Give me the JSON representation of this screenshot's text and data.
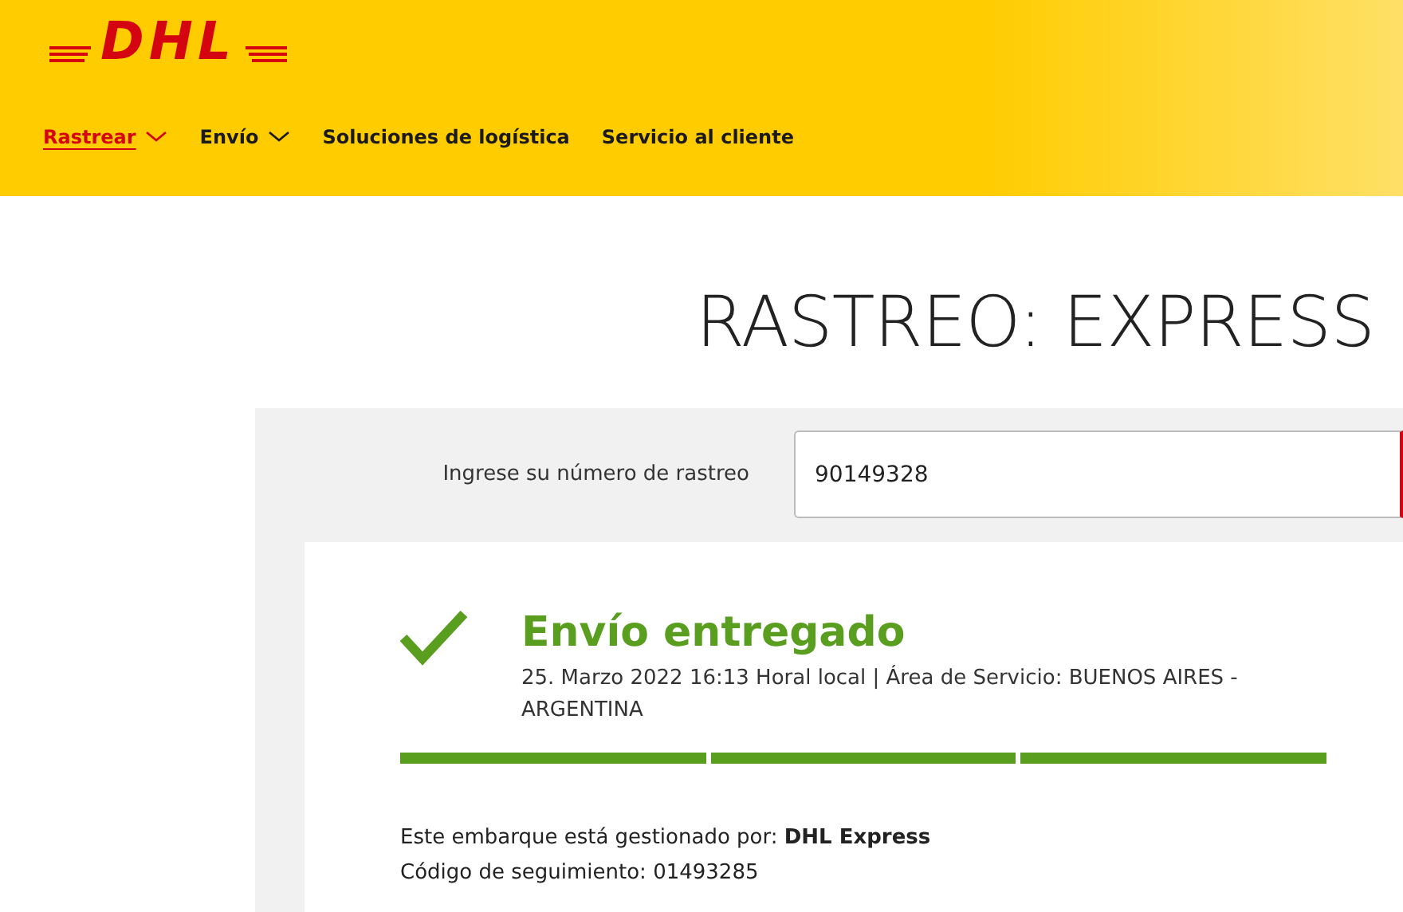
{
  "header": {
    "logo": "DHL"
  },
  "nav": [
    {
      "label": "Rastrear",
      "selected": true,
      "has_menu": true
    },
    {
      "label": "Envío",
      "selected": false,
      "has_menu": true
    },
    {
      "label": "Soluciones de logística",
      "selected": false,
      "has_menu": false
    },
    {
      "label": "Servicio al cliente",
      "selected": false,
      "has_menu": false
    }
  ],
  "title": "RASTREO: EXPRESS",
  "search": {
    "label": "Ingrese su número de rastreo",
    "value": "90149328"
  },
  "result": {
    "status": "Envío entregado",
    "delivered": true,
    "detail": "25. Marzo 2022 16:13 Horal local | Área de Servicio: BUENOS AIRES - ARGENTINA",
    "progress": [
      {
        "done": true
      },
      {
        "done": true
      },
      {
        "done": true
      }
    ],
    "handled_by": "Este embarque está gestionado por: **DHL Express**",
    "code_label": "Código de seguimiento:",
    "code": "01493285"
  }
}
